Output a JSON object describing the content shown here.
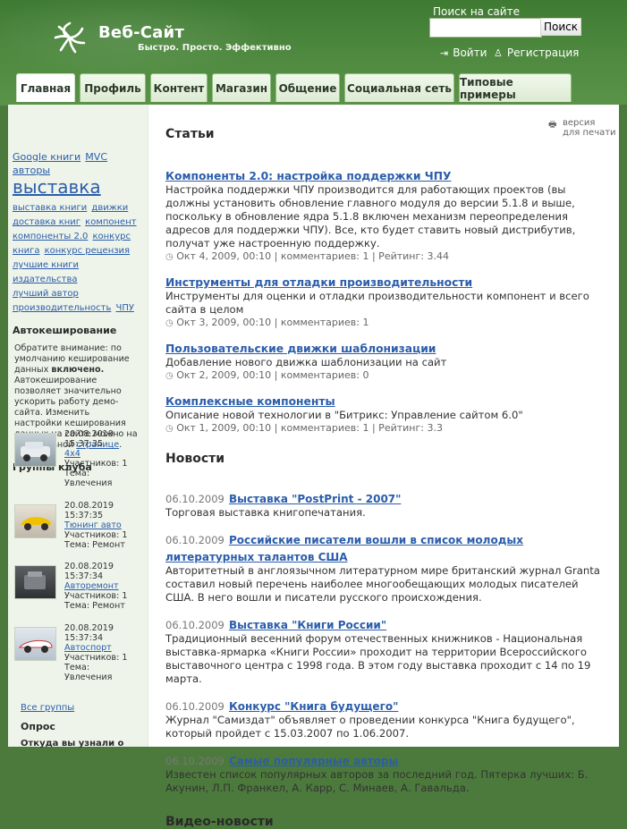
{
  "brand": {
    "title": "Веб-Сайт",
    "slogan": "Быстро. Просто. Эффективно"
  },
  "search": {
    "label": "Поиск на сайте",
    "button": "Поиск",
    "placeholder": ""
  },
  "auth": {
    "login": "Войти",
    "register": "Регистрация"
  },
  "tabs": [
    "Главная",
    "Профиль",
    "Контент",
    "Магазин",
    "Общение",
    "Социальная сеть",
    "Типовые примеры"
  ],
  "sidebar": {
    "tags": {
      "t1": "Google книги",
      "t2": "MVC",
      "t3": "авторы",
      "t4": "выставка",
      "t5": "выставка книги",
      "t6": "движки",
      "t7": "доставка книг",
      "t8": "компонент",
      "t9": "компоненты 2.0",
      "t10": "конкурс",
      "t11": "книга",
      "t12": "конкурс рецензия",
      "t13": "лучшие книги",
      "t14": "издательства",
      "t15": "лучший автор",
      "t16": "производительность",
      "t17": "ЧПУ"
    },
    "autocache": {
      "title": "Автокеширование",
      "text1": "Обратите внимание: по умолчанию кеширование данных",
      "text_bold": "включено.",
      "text2": "Автокеширование позволяет значительно ускорить работу демо-сайта. Изменить настройки кеширования данных на сайте можно на специальной",
      "link": "странице",
      "dot": "."
    },
    "groups_title": "Группы клуба",
    "groups": [
      {
        "date": "20.08.2019",
        "time": "15:37:35",
        "name": "4x4",
        "members": "Участников: 1",
        "topic": "Тема:",
        "topic_val": "Увлечения"
      },
      {
        "date": "20.08.2019",
        "time": "15:37:35",
        "name": "Тюнинг авто",
        "members": "Участников: 1",
        "topic": "Тема: Ремонт",
        "topic_val": ""
      },
      {
        "date": "20.08.2019",
        "time": "15:37:34",
        "name": "Авторемонт",
        "members": "Участников: 1",
        "topic": "Тема: Ремонт",
        "topic_val": ""
      },
      {
        "date": "20.08.2019",
        "time": "15:37:34",
        "name": "Автоспорт",
        "members": "Участников: 1",
        "topic": "Тема:",
        "topic_val": "Увлечения"
      }
    ],
    "all_groups": "Все группы",
    "poll_title": "Опрос",
    "poll_q": "Откуда вы узнали о"
  },
  "articles": {
    "title": "Статьи",
    "print": "версия\nдля печати",
    "items": [
      {
        "title": "Компоненты 2.0: настройка поддержки ЧПУ",
        "text": "Настройка поддержки ЧПУ производится для работающих проектов (вы должны установить обновление главного модуля до версии 5.1.8 и выше, поскольку в обновление ядра 5.1.8 включен механизм переопределения адресов для поддержки ЧПУ). Все, кто будет ставить новый дистрибутив, получат уже настроенную поддержку.",
        "meta": "Окт 4, 2009, 00:10 |   комментариев: 1 |   Рейтинг: 3.44"
      },
      {
        "title": "Инструменты для отладки производительности",
        "text": "Инструменты для оценки и отладки производительности компонент и всего сайта в целом",
        "meta": "Окт 3, 2009, 00:10 |   комментариев: 1"
      },
      {
        "title": "Пользовательские движки шаблонизации",
        "text": "Добавление нового движка шаблонизации на сайт",
        "meta": "Окт 2, 2009, 00:10 |   комментариев: 0"
      },
      {
        "title": "Комплексные компоненты",
        "text": "Описание новой технологии в \"Битрикс: Управление сайтом 6.0\"",
        "meta": "Окт 1, 2009, 00:10 |   комментариев: 1 |   Рейтинг: 3.3"
      }
    ]
  },
  "news": {
    "title": "Новости",
    "items": [
      {
        "date": "06.10.2009",
        "title": "Выставка \"PostPrint - 2007\"",
        "text": "Торговая выставка книгопечатания."
      },
      {
        "date": "06.10.2009",
        "title": "Российские писатели вошли в список молодых литературных талантов США",
        "text": "Авторитетный в англоязычном литературном мире британский журнал Granta составил новый перечень наиболее многообещающих молодых писателей США. В него вошли и писатели русского происхождения."
      },
      {
        "date": "06.10.2009",
        "title": "Выставка \"Книги России\"",
        "text": "Традиционный весенний форум отечественных книжников - Национальная выставка-ярмарка «Книги России» проходит на территории Всероссийского выставочного центра с 1998 года. В этом году выставка проходит с 14 по 19 марта."
      },
      {
        "date": "06.10.2009",
        "title": "Конкурс \"Книга будущего\"",
        "text": "Журнал \"Самиздат\" объявляет о проведении конкурса \"Книга будущего\", который пройдет с 15.03.2007 по 1.06.2007."
      },
      {
        "date": "06.10.2009",
        "title": "Самые популярные авторы",
        "text": "Известен список популярных авторов за последний год. Пятерка лучших: Б. Акунин, Л.П. Франкел, А. Карр, С. Минаев, А. Гавальда."
      }
    ]
  },
  "video": {
    "title": "Видео-новости"
  }
}
